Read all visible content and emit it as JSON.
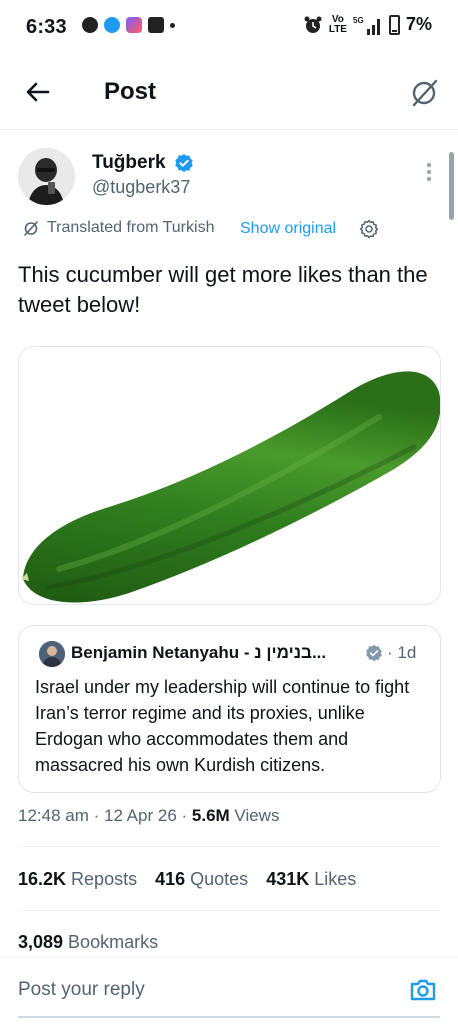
{
  "status_bar": {
    "time": "6:33",
    "battery": "7%",
    "network": "5G"
  },
  "header": {
    "title": "Post"
  },
  "post": {
    "author_name": "Tuğberk",
    "author_handle": "@tugberk37",
    "translated_label": "Translated from Turkish",
    "show_original_label": "Show original",
    "text": "This cucumber will get more likes than the tweet below!",
    "timestamp": "12:48 am · 12 Apr 26 · ",
    "views_count": "5.6M",
    "views_label": " Views",
    "reposts_count": "16.2K",
    "reposts_label": " Reposts",
    "quotes_count": "416",
    "quotes_label": " Quotes",
    "likes_count": "431K",
    "likes_label": " Likes",
    "bookmarks_count": "3,089",
    "bookmarks_label": " Bookmarks"
  },
  "quote": {
    "author_name": "Benjamin Netanyahu - בנימין נ...",
    "time": "· 1d",
    "text": "Israel under my leadership will continue to fight Iran’s terror regime and its proxies, unlike Erdogan who accommodates them and massacred his own Kurdish citizens."
  },
  "reply": {
    "placeholder": "Post your reply"
  },
  "colors": {
    "accent": "#1d9bf0",
    "secondary_text": "#536471",
    "cucumber": "#2f7d1e"
  }
}
